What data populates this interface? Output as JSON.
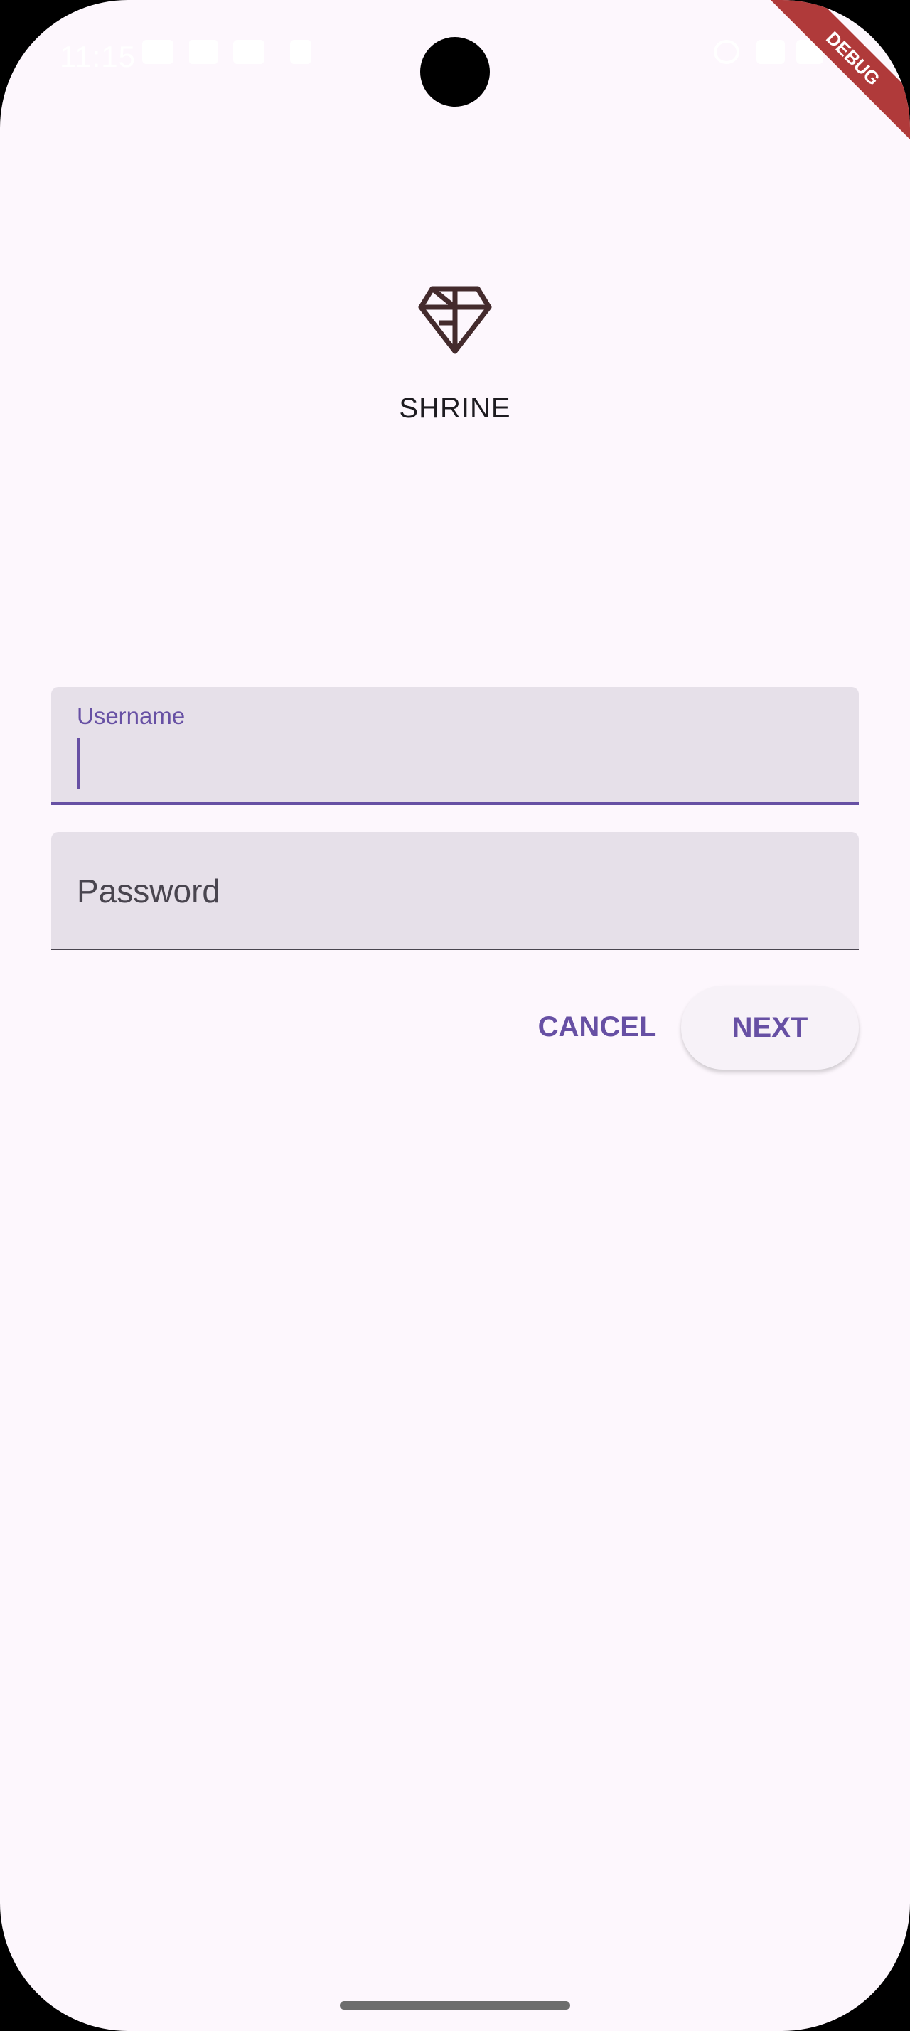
{
  "status_bar": {
    "time": "11:15",
    "debug_label": "DEBUG"
  },
  "app": {
    "name": "SHRINE",
    "logo_icon": "diamond-icon"
  },
  "form": {
    "username": {
      "label": "Username",
      "value": ""
    },
    "password": {
      "label": "Password",
      "value": ""
    }
  },
  "actions": {
    "cancel_label": "CANCEL",
    "next_label": "NEXT"
  },
  "colors": {
    "background": "#fdf7fd",
    "primary": "#6750a4",
    "field_fill": "#e6e0e9",
    "debug_banner": "#b03a3a"
  }
}
